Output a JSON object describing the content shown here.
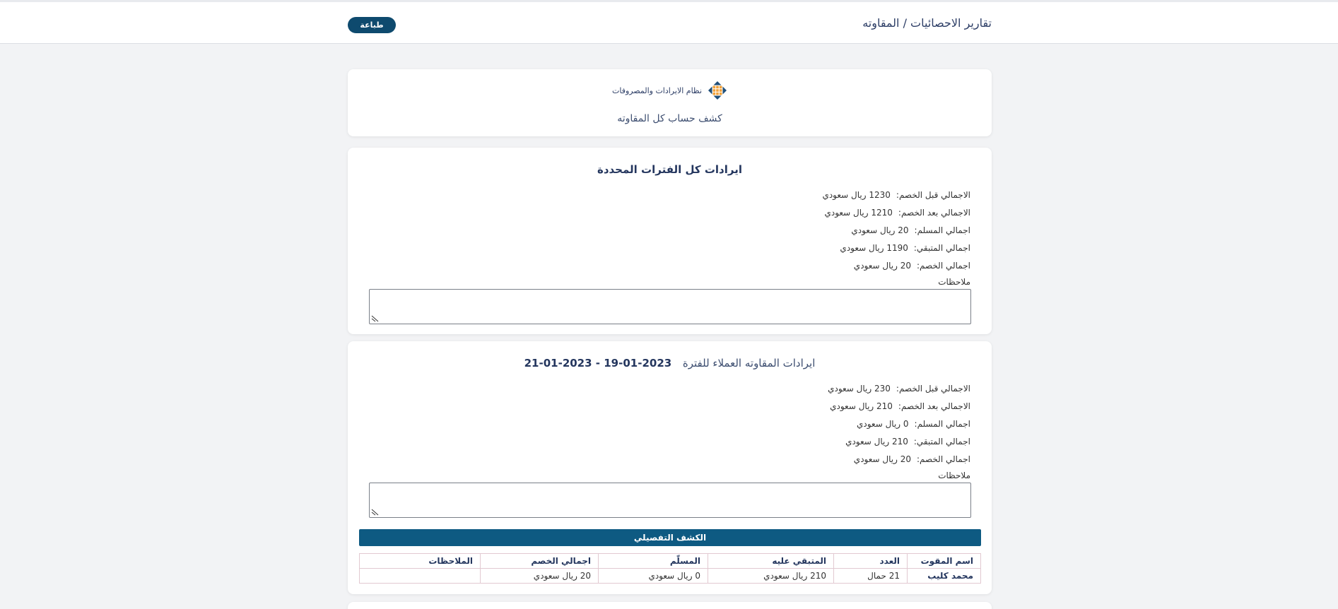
{
  "header": {
    "title": "تقارير الاحصائيات / المقاوته",
    "print_label": "طباعة"
  },
  "brand": {
    "name": "نظام الايرادات والمصروفات",
    "icon": "grid-logo-icon"
  },
  "report": {
    "subtitle": "كشف حساب كل المقاوته"
  },
  "summary": {
    "title": "ايرادات كل الفترات المحددة",
    "rows": [
      {
        "label": "الاجمالي قبل الخصم:",
        "value": "1230 ريال سعودي"
      },
      {
        "label": "الاجمالي بعد الخصم:",
        "value": "1210 ريال سعودي"
      },
      {
        "label": "اجمالي المسلم:",
        "value": "20 ريال سعودي"
      },
      {
        "label": "اجمالي المتبقي:",
        "value": "1190 ريال سعودي"
      },
      {
        "label": "اجمالي الخصم:",
        "value": "20 ريال سعودي"
      }
    ],
    "notes_label": "ملاحظات",
    "notes_value": ""
  },
  "period": {
    "title_prefix": "ايرادات المقاوته العملاء للفترة",
    "date_from": "2023-01-19",
    "date_sep": " - ",
    "date_to": "2023-01-21",
    "rows": [
      {
        "label": "الاجمالي قبل الخصم:",
        "value": "230 ريال سعودي"
      },
      {
        "label": "الاجمالي بعد الخصم:",
        "value": "210 ريال سعودي"
      },
      {
        "label": "اجمالي المسلم:",
        "value": "0 ريال سعودي"
      },
      {
        "label": "اجمالي المتبقي:",
        "value": "210 ريال سعودي"
      },
      {
        "label": "اجمالي الخصم:",
        "value": "20 ريال سعودي"
      }
    ],
    "notes_label": "ملاحظات",
    "notes_value": "",
    "detail_title": "الكشف التفصيلي",
    "table": {
      "headers": [
        "اسم المقوت",
        "العدد",
        "المتبقي عليه",
        "المسلّم",
        "اجمالي الخصم",
        "الملاحظات"
      ],
      "rows": [
        [
          "محمد كليب",
          "21 حمال",
          "210 ريال سعودي",
          "0 ريال سعودي",
          "20 ريال سعودي",
          ""
        ]
      ]
    }
  }
}
